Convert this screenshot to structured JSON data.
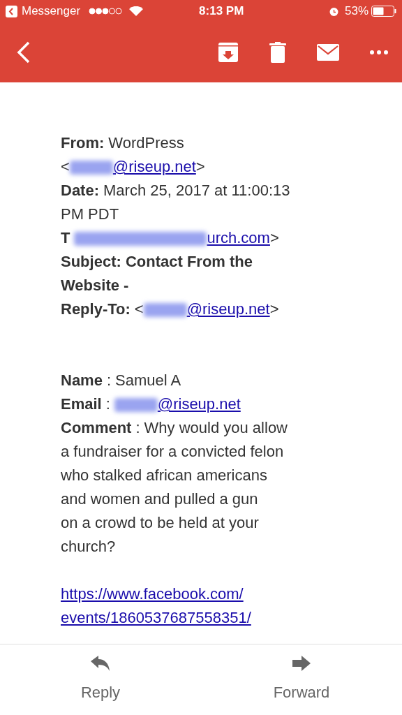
{
  "status_bar": {
    "back_app": "Messenger",
    "time": "8:13 PM",
    "battery": "53%"
  },
  "toolbar": {
    "actions": [
      {
        "kind": "archive"
      },
      {
        "kind": "delete"
      },
      {
        "kind": "unread"
      },
      {
        "kind": "more"
      }
    ]
  },
  "header_lines": [
    {
      "segments": [
        {
          "kind": "label",
          "text": "From:"
        },
        {
          "kind": "text",
          "text": "WordPress"
        }
      ]
    },
    {
      "segments": [
        {
          "kind": "text",
          "text": "<"
        },
        {
          "kind": "redacted_short"
        },
        {
          "kind": "link",
          "text": "@riseup.net"
        },
        {
          "kind": "text",
          "text": ">"
        }
      ]
    },
    {
      "segments": [
        {
          "kind": "label",
          "text": "Date:"
        },
        {
          "kind": "text",
          "text": "March 25, 2017 at 11:00:13"
        }
      ]
    },
    {
      "segments": [
        {
          "kind": "text",
          "text": "PM PDT"
        }
      ]
    },
    {
      "segments": [
        {
          "kind": "label",
          "text": "T"
        },
        {
          "kind": "redacted_long"
        },
        {
          "kind": "link",
          "text": "urch.com"
        },
        {
          "kind": "text",
          "text": ">"
        }
      ]
    },
    {
      "segments": [
        {
          "kind": "label",
          "text": "Subject: Contact From the"
        }
      ]
    },
    {
      "segments": [
        {
          "kind": "label",
          "text": "Website -"
        }
      ]
    },
    {
      "segments": [
        {
          "kind": "label",
          "text": "Reply-To:"
        },
        {
          "kind": "text",
          "text": "<"
        },
        {
          "kind": "redacted_short"
        },
        {
          "kind": "link",
          "text": "@riseup.net"
        },
        {
          "kind": "text",
          "text": ">"
        }
      ]
    }
  ],
  "form_fields": [
    {
      "label": "Name",
      "separator": ":",
      "kind": "text",
      "lines": [
        "Samuel A"
      ]
    },
    {
      "label": "Email",
      "separator": ":",
      "kind": "email",
      "lines": [
        "@riseup.net"
      ]
    },
    {
      "label": "Comment",
      "separator": ":",
      "kind": "text",
      "lines": [
        "Why would you allow",
        "a fundraiser for a convicted felon",
        "who stalked african americans",
        "and women and pulled a gun",
        "on a crowd to be held at your",
        "church?"
      ]
    }
  ],
  "link_lines": [
    "https://www.facebook.com/",
    "events/1860537687558351/"
  ],
  "actions": [
    {
      "kind": "reply",
      "label": "Reply"
    },
    {
      "kind": "forward",
      "label": "Forward"
    }
  ]
}
